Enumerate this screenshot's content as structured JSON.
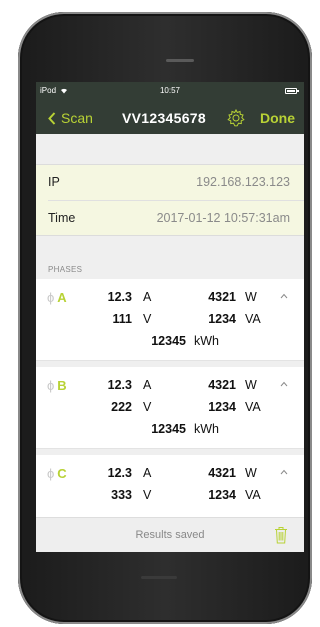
{
  "status_bar": {
    "carrier": "iPod",
    "time": "10:57"
  },
  "nav": {
    "back_label": "Scan",
    "title": "VV12345678",
    "done_label": "Done"
  },
  "info": {
    "ip_label": "IP",
    "ip_value": "192.168.123.123",
    "time_label": "Time",
    "time_value": "2017-01-12 10:57:31am"
  },
  "phases_header": "PHASES",
  "phases": [
    {
      "name": "A",
      "current": "12.3",
      "current_unit": "A",
      "power": "4321",
      "power_unit": "W",
      "voltage": "111",
      "voltage_unit": "V",
      "apparent": "1234",
      "apparent_unit": "VA",
      "energy": "12345",
      "energy_unit": "kWh"
    },
    {
      "name": "B",
      "current": "12.3",
      "current_unit": "A",
      "power": "4321",
      "power_unit": "W",
      "voltage": "222",
      "voltage_unit": "V",
      "apparent": "1234",
      "apparent_unit": "VA",
      "energy": "12345",
      "energy_unit": "kWh"
    },
    {
      "name": "C",
      "current": "12.3",
      "current_unit": "A",
      "power": "4321",
      "power_unit": "W",
      "voltage": "333",
      "voltage_unit": "V",
      "apparent": "1234",
      "apparent_unit": "VA"
    }
  ],
  "footer": {
    "status_text": "Results saved"
  },
  "colors": {
    "accent": "#b8d235",
    "navbar": "#333d35",
    "info_bg": "#f5f7e1"
  },
  "icons": {
    "back": "chevron-left-icon",
    "settings": "gear-icon",
    "collapse": "chevron-up-icon",
    "delete": "trash-icon",
    "phase": "phi-symbol"
  }
}
